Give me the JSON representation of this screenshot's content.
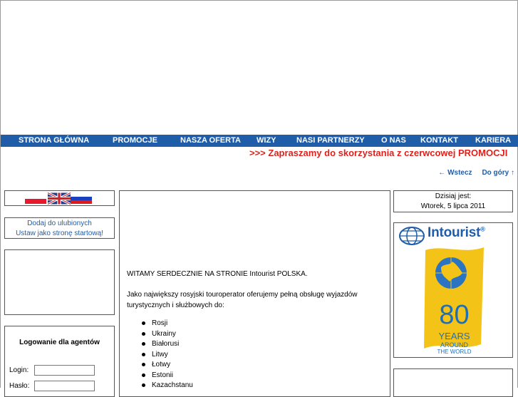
{
  "nav": {
    "items": [
      "STRONA GŁÓWNA",
      "PROMOCJE",
      "NASZA OFERTA",
      "WIZY",
      "NASI PARTNERZY",
      "O NAS",
      "KONTAKT",
      "KARIERA"
    ]
  },
  "marquee": ">>> Zapraszamy do skorzystania z czerwcowej PROMOCJI",
  "backlinks": {
    "back": "← Wstecz",
    "top": "Do góry ↑"
  },
  "favorites": {
    "add": "Dodaj do ulubionych",
    "home": "Ustaw jako stronę startową!"
  },
  "login": {
    "title": "Logowanie dla agentów",
    "login_label": "Login:",
    "password_label": "Hasło:"
  },
  "main": {
    "welcome": "WITAMY SERDECZNIE NA STRONIE Intourist POLSKA.",
    "intro_line1": "Jako największy rosyjski touroperator oferujemy pełną obsługę wyjazdów",
    "intro_line2": "turystycznych i służbowych do:",
    "countries": [
      "Rosji",
      "Ukrainy",
      "Białorusi",
      "Litwy",
      "Łotwy",
      "Estonii",
      "Kazachstanu"
    ]
  },
  "date": {
    "label": "Dzisiaj jest:",
    "value": "Wtorek, 5 lipca 2011"
  },
  "logo": {
    "brand": "Intourist",
    "reg": "®",
    "anniversary": "80",
    "years": "YEARS",
    "around": "AROUND",
    "world": "THE WORLD"
  },
  "colors": {
    "nav_bg": "#1f5da8",
    "marquee": "#e0201a",
    "link": "#1f5da8",
    "flag_yellow": "#f4c318"
  }
}
